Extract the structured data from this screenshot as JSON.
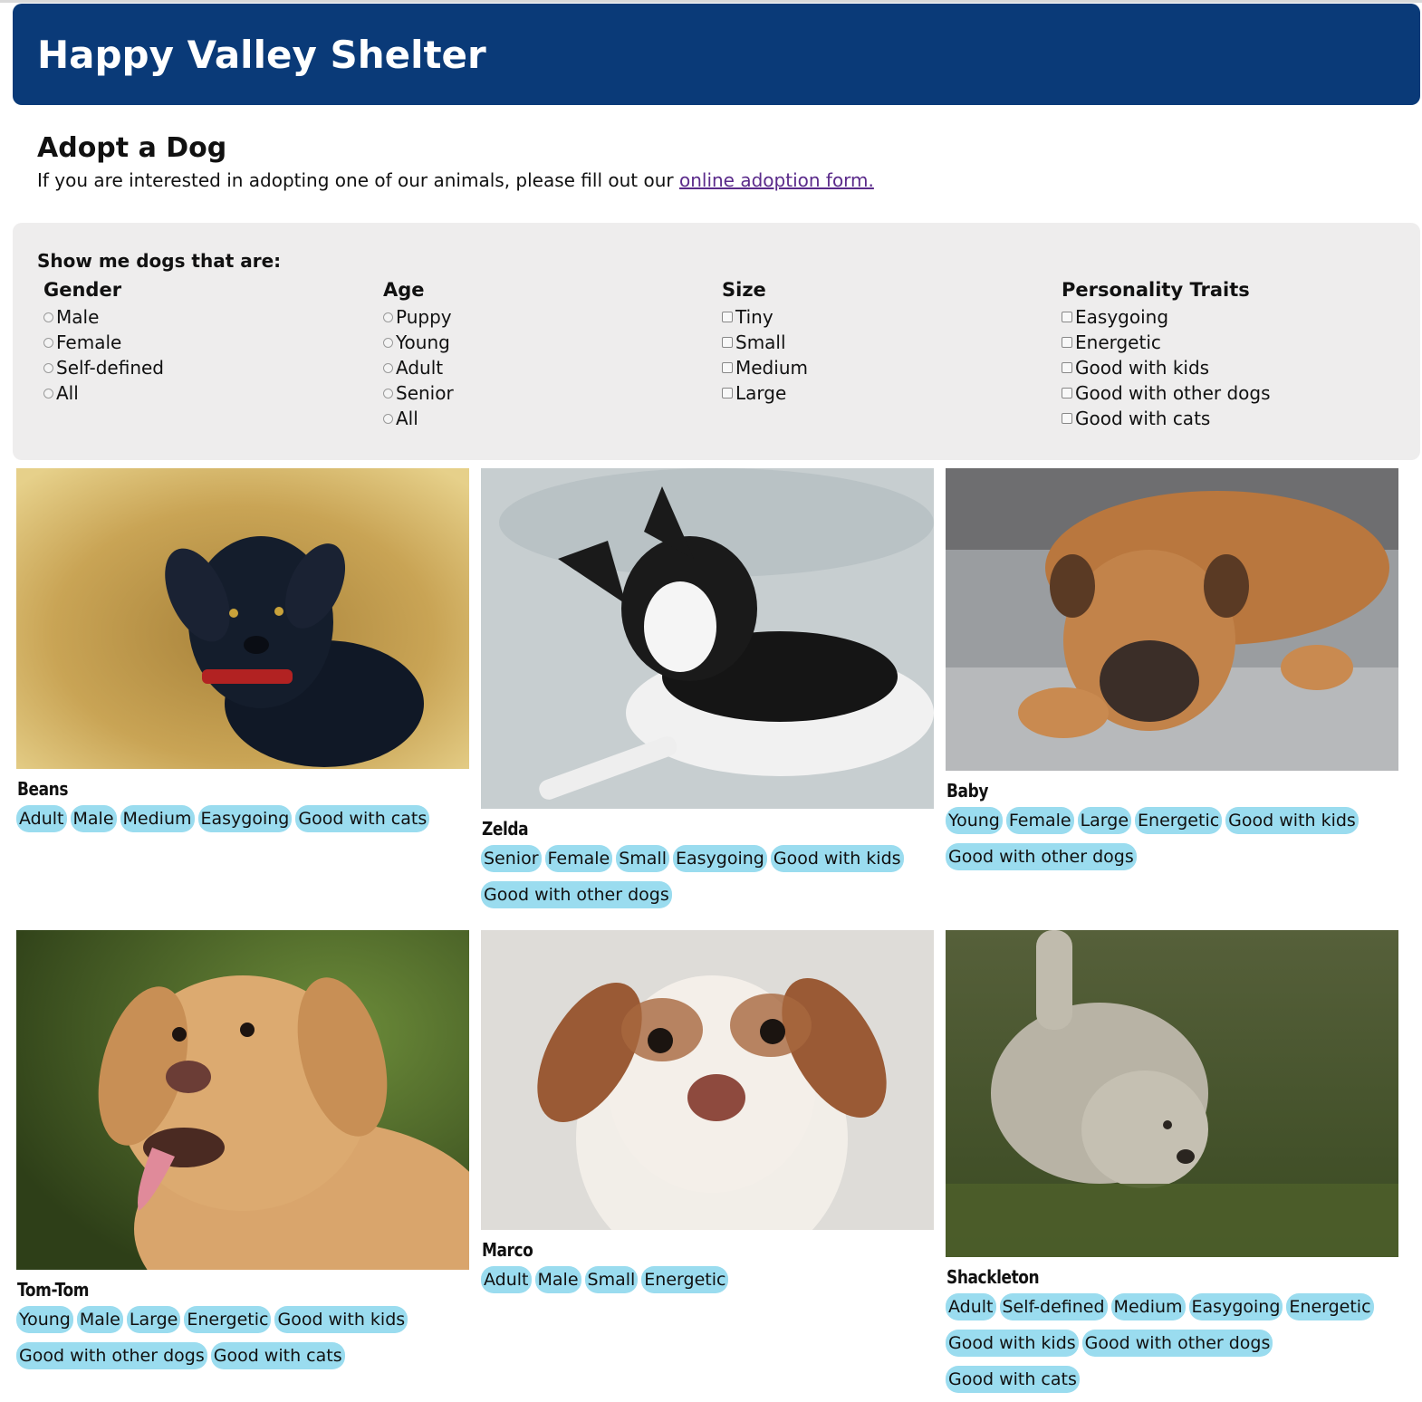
{
  "site": {
    "title": "Happy Valley Shelter"
  },
  "intro": {
    "heading": "Adopt a Dog",
    "text": "If you are interested in adopting one of our animals, please fill out our ",
    "link_text": "online adoption form."
  },
  "filters": {
    "heading": "Show me dogs that are:",
    "gender": {
      "title": "Gender",
      "options": [
        "Male",
        "Female",
        "Self-defined",
        "All"
      ]
    },
    "age": {
      "title": "Age",
      "options": [
        "Puppy",
        "Young",
        "Adult",
        "Senior",
        "All"
      ]
    },
    "size": {
      "title": "Size",
      "options": [
        "Tiny",
        "Small",
        "Medium",
        "Large"
      ]
    },
    "traits": {
      "title": "Personality Traits",
      "options": [
        "Easygoing",
        "Energetic",
        "Good with kids",
        "Good with other dogs",
        "Good with cats"
      ]
    }
  },
  "dogs": [
    {
      "name": "Beans",
      "tags": [
        "Adult",
        "Male",
        "Medium",
        "Easygoing",
        "Good with cats"
      ]
    },
    {
      "name": "Zelda",
      "tags": [
        "Senior",
        "Female",
        "Small",
        "Easygoing",
        "Good with kids",
        "Good with other dogs"
      ]
    },
    {
      "name": "Baby",
      "tags": [
        "Young",
        "Female",
        "Large",
        "Energetic",
        "Good with kids",
        "Good with other dogs"
      ]
    },
    {
      "name": "Tom-Tom",
      "tags": [
        "Young",
        "Male",
        "Large",
        "Energetic",
        "Good with kids",
        "Good with other dogs",
        "Good with cats"
      ]
    },
    {
      "name": "Marco",
      "tags": [
        "Adult",
        "Male",
        "Small",
        "Energetic"
      ]
    },
    {
      "name": "Shackleton",
      "tags": [
        "Adult",
        "Self-defined",
        "Medium",
        "Easygoing",
        "Energetic",
        "Good with kids",
        "Good with other dogs",
        "Good with cats"
      ]
    }
  ],
  "colors": {
    "banner": "#0a3a78",
    "panel": "#eeeded",
    "tag": "#9adcef",
    "link": "#5a2a8a"
  }
}
